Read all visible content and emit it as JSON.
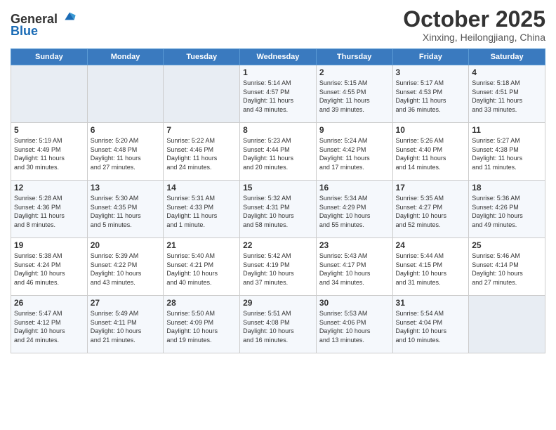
{
  "header": {
    "logo_line1": "General",
    "logo_line2": "Blue",
    "month": "October 2025",
    "location": "Xinxing, Heilongjiang, China"
  },
  "weekdays": [
    "Sunday",
    "Monday",
    "Tuesday",
    "Wednesday",
    "Thursday",
    "Friday",
    "Saturday"
  ],
  "weeks": [
    [
      {
        "day": "",
        "info": ""
      },
      {
        "day": "",
        "info": ""
      },
      {
        "day": "",
        "info": ""
      },
      {
        "day": "1",
        "info": "Sunrise: 5:14 AM\nSunset: 4:57 PM\nDaylight: 11 hours\nand 43 minutes."
      },
      {
        "day": "2",
        "info": "Sunrise: 5:15 AM\nSunset: 4:55 PM\nDaylight: 11 hours\nand 39 minutes."
      },
      {
        "day": "3",
        "info": "Sunrise: 5:17 AM\nSunset: 4:53 PM\nDaylight: 11 hours\nand 36 minutes."
      },
      {
        "day": "4",
        "info": "Sunrise: 5:18 AM\nSunset: 4:51 PM\nDaylight: 11 hours\nand 33 minutes."
      }
    ],
    [
      {
        "day": "5",
        "info": "Sunrise: 5:19 AM\nSunset: 4:49 PM\nDaylight: 11 hours\nand 30 minutes."
      },
      {
        "day": "6",
        "info": "Sunrise: 5:20 AM\nSunset: 4:48 PM\nDaylight: 11 hours\nand 27 minutes."
      },
      {
        "day": "7",
        "info": "Sunrise: 5:22 AM\nSunset: 4:46 PM\nDaylight: 11 hours\nand 24 minutes."
      },
      {
        "day": "8",
        "info": "Sunrise: 5:23 AM\nSunset: 4:44 PM\nDaylight: 11 hours\nand 20 minutes."
      },
      {
        "day": "9",
        "info": "Sunrise: 5:24 AM\nSunset: 4:42 PM\nDaylight: 11 hours\nand 17 minutes."
      },
      {
        "day": "10",
        "info": "Sunrise: 5:26 AM\nSunset: 4:40 PM\nDaylight: 11 hours\nand 14 minutes."
      },
      {
        "day": "11",
        "info": "Sunrise: 5:27 AM\nSunset: 4:38 PM\nDaylight: 11 hours\nand 11 minutes."
      }
    ],
    [
      {
        "day": "12",
        "info": "Sunrise: 5:28 AM\nSunset: 4:36 PM\nDaylight: 11 hours\nand 8 minutes."
      },
      {
        "day": "13",
        "info": "Sunrise: 5:30 AM\nSunset: 4:35 PM\nDaylight: 11 hours\nand 5 minutes."
      },
      {
        "day": "14",
        "info": "Sunrise: 5:31 AM\nSunset: 4:33 PM\nDaylight: 11 hours\nand 1 minute."
      },
      {
        "day": "15",
        "info": "Sunrise: 5:32 AM\nSunset: 4:31 PM\nDaylight: 10 hours\nand 58 minutes."
      },
      {
        "day": "16",
        "info": "Sunrise: 5:34 AM\nSunset: 4:29 PM\nDaylight: 10 hours\nand 55 minutes."
      },
      {
        "day": "17",
        "info": "Sunrise: 5:35 AM\nSunset: 4:27 PM\nDaylight: 10 hours\nand 52 minutes."
      },
      {
        "day": "18",
        "info": "Sunrise: 5:36 AM\nSunset: 4:26 PM\nDaylight: 10 hours\nand 49 minutes."
      }
    ],
    [
      {
        "day": "19",
        "info": "Sunrise: 5:38 AM\nSunset: 4:24 PM\nDaylight: 10 hours\nand 46 minutes."
      },
      {
        "day": "20",
        "info": "Sunrise: 5:39 AM\nSunset: 4:22 PM\nDaylight: 10 hours\nand 43 minutes."
      },
      {
        "day": "21",
        "info": "Sunrise: 5:40 AM\nSunset: 4:21 PM\nDaylight: 10 hours\nand 40 minutes."
      },
      {
        "day": "22",
        "info": "Sunrise: 5:42 AM\nSunset: 4:19 PM\nDaylight: 10 hours\nand 37 minutes."
      },
      {
        "day": "23",
        "info": "Sunrise: 5:43 AM\nSunset: 4:17 PM\nDaylight: 10 hours\nand 34 minutes."
      },
      {
        "day": "24",
        "info": "Sunrise: 5:44 AM\nSunset: 4:15 PM\nDaylight: 10 hours\nand 31 minutes."
      },
      {
        "day": "25",
        "info": "Sunrise: 5:46 AM\nSunset: 4:14 PM\nDaylight: 10 hours\nand 27 minutes."
      }
    ],
    [
      {
        "day": "26",
        "info": "Sunrise: 5:47 AM\nSunset: 4:12 PM\nDaylight: 10 hours\nand 24 minutes."
      },
      {
        "day": "27",
        "info": "Sunrise: 5:49 AM\nSunset: 4:11 PM\nDaylight: 10 hours\nand 21 minutes."
      },
      {
        "day": "28",
        "info": "Sunrise: 5:50 AM\nSunset: 4:09 PM\nDaylight: 10 hours\nand 19 minutes."
      },
      {
        "day": "29",
        "info": "Sunrise: 5:51 AM\nSunset: 4:08 PM\nDaylight: 10 hours\nand 16 minutes."
      },
      {
        "day": "30",
        "info": "Sunrise: 5:53 AM\nSunset: 4:06 PM\nDaylight: 10 hours\nand 13 minutes."
      },
      {
        "day": "31",
        "info": "Sunrise: 5:54 AM\nSunset: 4:04 PM\nDaylight: 10 hours\nand 10 minutes."
      },
      {
        "day": "",
        "info": ""
      }
    ]
  ]
}
